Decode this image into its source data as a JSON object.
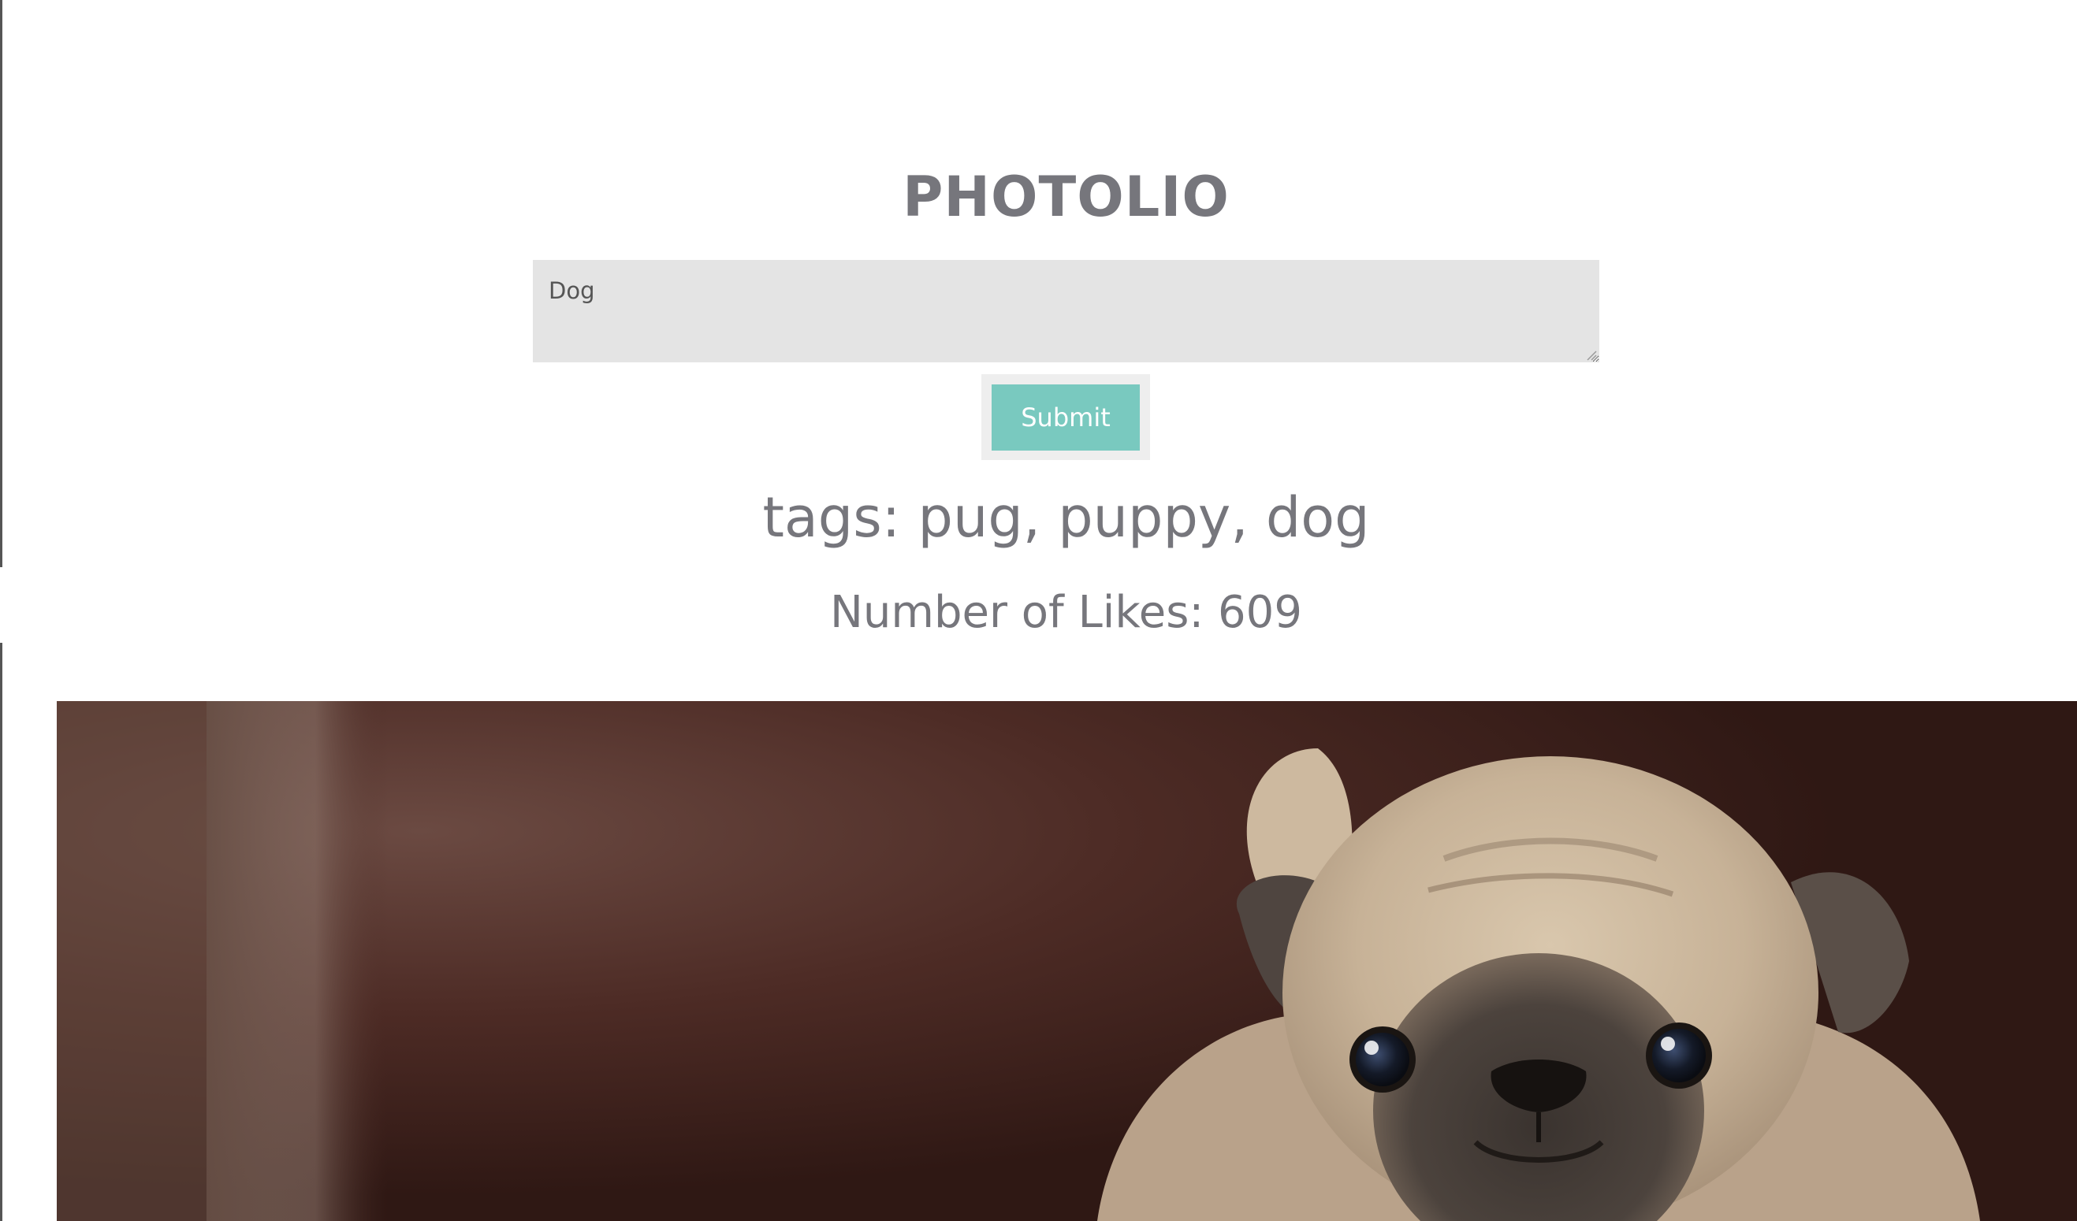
{
  "app": {
    "title": "PHOTOLIO"
  },
  "search": {
    "value": "Dog"
  },
  "actions": {
    "submit_label": "Submit"
  },
  "result": {
    "tags_text": "tags: pug, puppy, dog",
    "likes_text": "Number of Likes: 609"
  },
  "photo": {
    "subject": "pug puppy on dark wooden floor"
  },
  "colors": {
    "heading": "#76767c",
    "input_bg": "#e4e4e4",
    "button_bg": "#79c9bf",
    "button_frame": "#eeeeee"
  }
}
